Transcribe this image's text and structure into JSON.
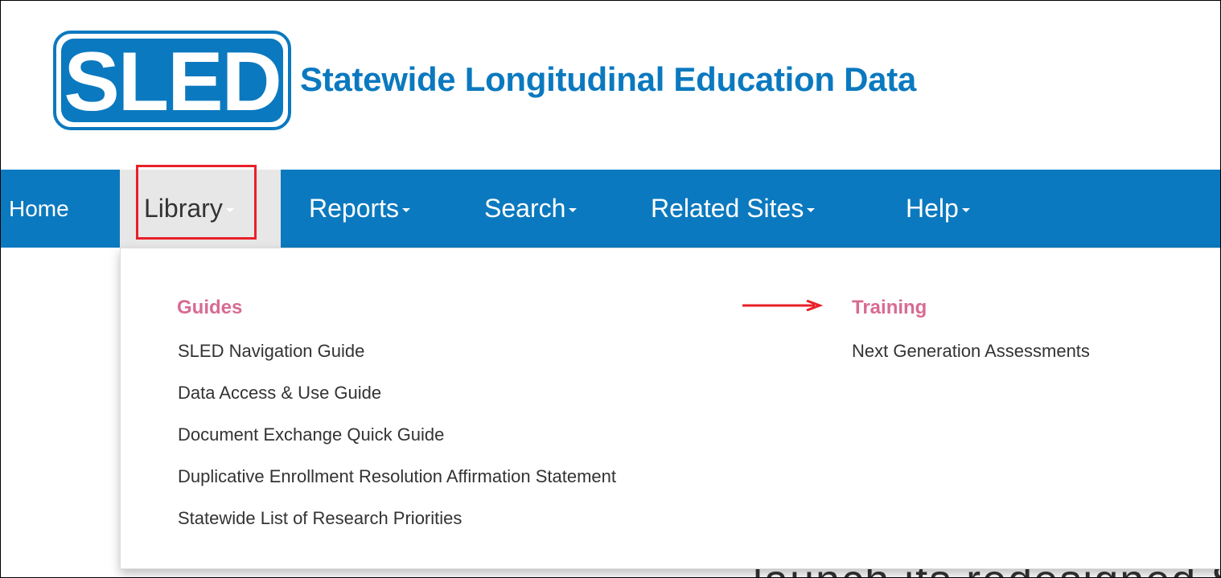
{
  "logo": {
    "text": "SLED"
  },
  "site_title": "Statewide Longitudinal Education Data",
  "nav": {
    "home": "Home",
    "library": "Library",
    "reports": "Reports",
    "search": "Search",
    "related_sites": "Related Sites",
    "help": "Help"
  },
  "dropdown": {
    "guides": {
      "heading": "Guides",
      "items": [
        "SLED Navigation Guide",
        "Data Access & Use Guide",
        "Document Exchange Quick Guide",
        "Duplicative Enrollment Resolution Affirmation Statement",
        "Statewide List of Research Priorities"
      ]
    },
    "training": {
      "heading": "Training",
      "items": [
        "Next Generation Assessments"
      ]
    }
  },
  "background_text": "launch its redesigned State",
  "colors": {
    "brand_blue": "#0b79bf",
    "heading_pink": "#d76b92",
    "annotation_red": "#e8202a"
  }
}
